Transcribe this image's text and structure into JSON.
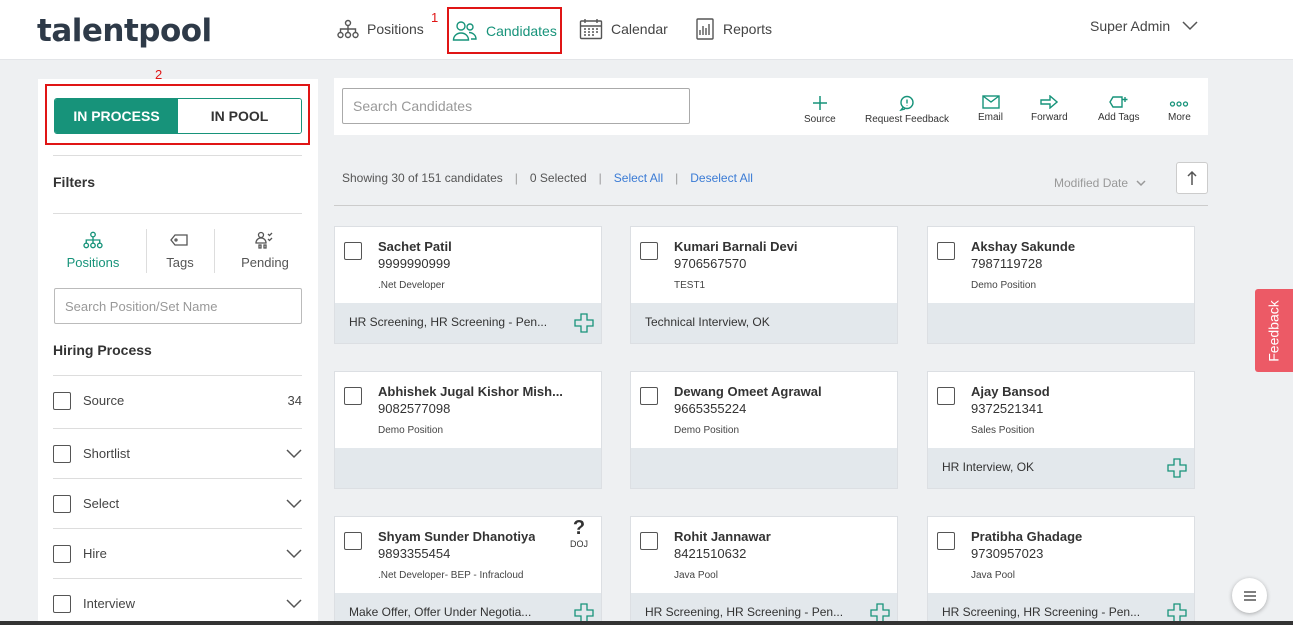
{
  "header": {
    "logo": "talentpool",
    "nav": {
      "positions": "Positions",
      "candidates": "Candidates",
      "calendar": "Calendar",
      "reports": "Reports"
    },
    "user": "Super Admin",
    "annotation_1": "1",
    "annotation_2": "2"
  },
  "sidebar": {
    "toggle_active": "IN PROCESS",
    "toggle_inactive": "IN POOL",
    "filters_title": "Filters",
    "tabs": {
      "positions": "Positions",
      "tags": "Tags",
      "pending": "Pending"
    },
    "search_placeholder": "Search Position/Set Name",
    "hiring_process_title": "Hiring Process",
    "stages": [
      {
        "label": "Source",
        "count": "34"
      },
      {
        "label": "Shortlist"
      },
      {
        "label": "Select"
      },
      {
        "label": "Hire"
      },
      {
        "label": "Interview"
      }
    ]
  },
  "toolbar": {
    "search_placeholder": "Search Candidates",
    "actions": {
      "source": "Source",
      "request_feedback": "Request Feedback",
      "email": "Email",
      "forward": "Forward",
      "add_tags": "Add Tags",
      "more": "More"
    }
  },
  "info": {
    "showing": "Showing 30 of 151 candidates",
    "selected": "0 Selected",
    "select_all": "Select All",
    "deselect_all": "Deselect All",
    "sort_label": "Modified Date"
  },
  "cards": [
    {
      "name": "Sachet Patil",
      "phone": "9999990999",
      "position": ".Net Developer",
      "stage": "HR Screening, HR Screening - Pen..."
    },
    {
      "name": "Kumari Barnali Devi",
      "phone": "9706567570",
      "position": "TEST1",
      "stage": "Technical Interview, OK"
    },
    {
      "name": "Akshay Sakunde",
      "phone": "7987119728",
      "position": "Demo Position",
      "stage": ""
    },
    {
      "name": "Abhishek Jugal Kishor Mish...",
      "phone": "9082577098",
      "position": "Demo Position",
      "stage": ""
    },
    {
      "name": "Dewang Omeet Agrawal",
      "phone": "9665355224",
      "position": "Demo Position",
      "stage": ""
    },
    {
      "name": "Ajay Bansod",
      "phone": "9372521341",
      "position": "Sales Position",
      "stage": "HR Interview, OK"
    },
    {
      "name": "Shyam Sunder Dhanotiya",
      "phone": "9893355454",
      "position": ".Net Developer- BEP - Infracloud",
      "stage": "Make Offer, Offer Under Negotia...",
      "doj": "DOJ"
    },
    {
      "name": "Rohit Jannawar",
      "phone": "8421510632",
      "position": "Java Pool",
      "stage": "HR Screening, HR Screening - Pen..."
    },
    {
      "name": "Pratibha Ghadage",
      "phone": "9730957023",
      "position": "Java Pool",
      "stage": "HR Screening, HR Screening - Pen..."
    }
  ],
  "feedback_tab": "Feedback",
  "colors": {
    "accent": "#17937a",
    "annotation": "#e01515",
    "feedback": "#ec5a66",
    "link": "#3a7bd5"
  }
}
